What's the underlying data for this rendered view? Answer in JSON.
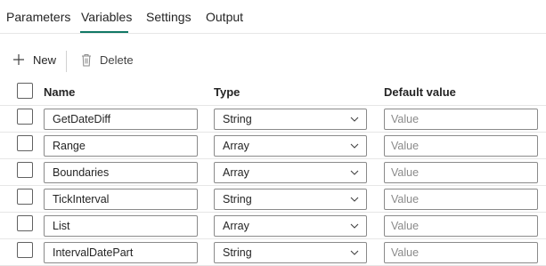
{
  "tabs": [
    {
      "label": "Parameters",
      "active": false
    },
    {
      "label": "Variables",
      "active": true
    },
    {
      "label": "Settings",
      "active": false
    },
    {
      "label": "Output",
      "active": false
    }
  ],
  "toolbar": {
    "new_label": "New",
    "new_icon": "plus-icon",
    "delete_label": "Delete",
    "delete_icon": "trash-icon"
  },
  "table": {
    "headers": {
      "name": "Name",
      "type": "Type",
      "default": "Default value"
    },
    "placeholder": "Value",
    "rows": [
      {
        "name": "GetDateDiff",
        "type": "String"
      },
      {
        "name": "Range",
        "type": "Array"
      },
      {
        "name": "Boundaries",
        "type": "Array"
      },
      {
        "name": "TickInterval",
        "type": "String"
      },
      {
        "name": "List",
        "type": "Array"
      },
      {
        "name": "IntervalDatePart",
        "type": "String"
      }
    ]
  },
  "colors": {
    "accent": "#117865"
  }
}
